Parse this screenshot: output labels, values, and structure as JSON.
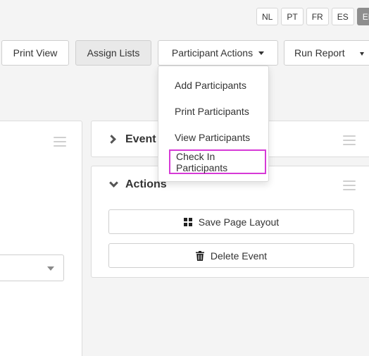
{
  "languages": [
    {
      "code": "NL",
      "active": false
    },
    {
      "code": "PT",
      "active": false
    },
    {
      "code": "FR",
      "active": false
    },
    {
      "code": "ES",
      "active": false
    },
    {
      "code": "EN",
      "active": true
    }
  ],
  "toolbar": {
    "print_view": "Print View",
    "assign_lists": "Assign Lists",
    "participant_actions": "Participant Actions",
    "run_report": "Run Report"
  },
  "participant_menu": {
    "items": [
      "Add Participants",
      "Print Participants",
      "View Participants",
      "Check In Participants"
    ]
  },
  "panels": {
    "event_title": "Event",
    "actions_title": "Actions",
    "save_layout": "Save Page Layout",
    "delete_event": "Delete Event"
  },
  "colors": {
    "highlight": "#d63ad6",
    "active_lang_bg": "#8e8e8e"
  }
}
